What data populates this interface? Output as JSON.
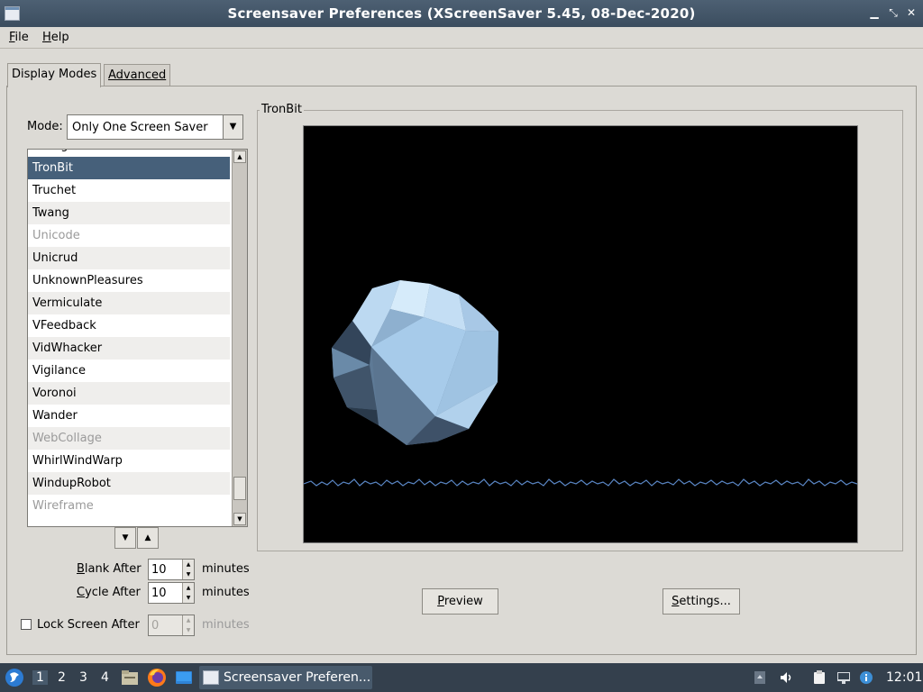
{
  "window": {
    "title": "Screensaver Preferences  (XScreenSaver 5.45, 08-Dec-2020)",
    "controls": [
      "minimize-icon",
      "maximize-icon",
      "close-icon"
    ]
  },
  "menubar": {
    "file": "File",
    "help": "Help"
  },
  "tabs": [
    {
      "label": "Display Modes",
      "active": true
    },
    {
      "label": "Advanced",
      "active": false
    }
  ],
  "mode": {
    "label": "Mode:",
    "value": "Only One Screen Saver"
  },
  "screensavers": [
    {
      "name": "Triangle",
      "state": "normal"
    },
    {
      "name": "TronBit",
      "state": "selected"
    },
    {
      "name": "Truchet",
      "state": "normal"
    },
    {
      "name": "Twang",
      "state": "normal"
    },
    {
      "name": "Unicode",
      "state": "disabled"
    },
    {
      "name": "Unicrud",
      "state": "normal"
    },
    {
      "name": "UnknownPleasures",
      "state": "normal"
    },
    {
      "name": "Vermiculate",
      "state": "normal"
    },
    {
      "name": "VFeedback",
      "state": "normal"
    },
    {
      "name": "VidWhacker",
      "state": "normal"
    },
    {
      "name": "Vigilance",
      "state": "normal"
    },
    {
      "name": "Voronoi",
      "state": "normal"
    },
    {
      "name": "Wander",
      "state": "normal"
    },
    {
      "name": "WebCollage",
      "state": "disabled"
    },
    {
      "name": "WhirlWindWarp",
      "state": "normal"
    },
    {
      "name": "WindupRobot",
      "state": "normal"
    },
    {
      "name": "Wireframe",
      "state": "disabled"
    }
  ],
  "timing": {
    "blank_label": "Blank After",
    "blank_value": "10",
    "cycle_label": "Cycle After",
    "cycle_value": "10",
    "lock_label": "Lock Screen After",
    "lock_value": "0",
    "lock_checked": false,
    "unit": "minutes"
  },
  "preview": {
    "title": "TronBit",
    "preview_button": "Preview",
    "settings_button": "Settings..."
  },
  "taskbar": {
    "workspaces": [
      "1",
      "2",
      "3",
      "4"
    ],
    "active_workspace": "1",
    "window_button": "Screensaver Preferen...",
    "clock": "12:01"
  }
}
